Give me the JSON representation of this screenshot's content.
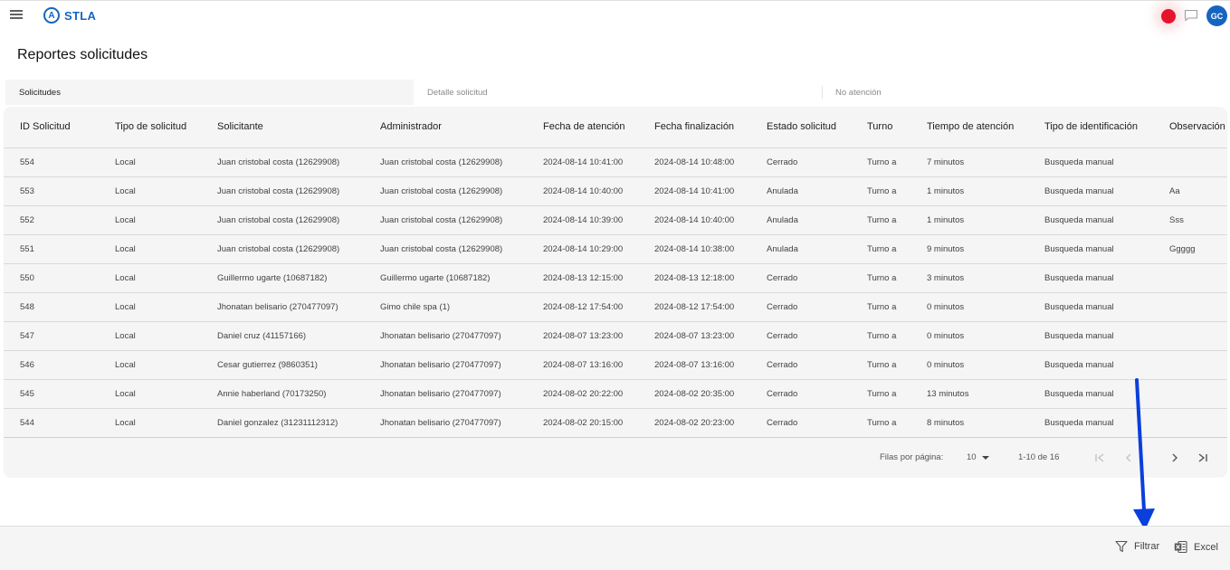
{
  "header": {
    "brand": "STLA",
    "logo_glyph": "A",
    "avatar_initials": "GC",
    "accent_color": "#1565c0",
    "record_color": "#e5142b"
  },
  "page": {
    "title": "Reportes solicitudes"
  },
  "tabs": [
    {
      "label": "Solicitudes",
      "active": true
    },
    {
      "label": "Detalle solicitud",
      "active": false
    },
    {
      "label": "No atención",
      "active": false
    }
  ],
  "table": {
    "columns": [
      "ID Solicitud",
      "Tipo de solicitud",
      "Solicitante",
      "Administrador",
      "Fecha de atención",
      "Fecha finalización",
      "Estado solicitud",
      "Turno",
      "Tiempo de atención",
      "Tipo de identificación",
      "Observación"
    ],
    "rows": [
      [
        "554",
        "Local",
        "Juan cristobal costa  (12629908)",
        "Juan cristobal costa  (12629908)",
        "2024-08-14 10:41:00",
        "2024-08-14 10:48:00",
        "Cerrado",
        "Turno a",
        "7 minutos",
        "Busqueda manual",
        ""
      ],
      [
        "553",
        "Local",
        "Juan cristobal costa  (12629908)",
        "Juan cristobal costa  (12629908)",
        "2024-08-14 10:40:00",
        "2024-08-14 10:41:00",
        "Anulada",
        "Turno a",
        "1 minutos",
        "Busqueda manual",
        "Aa"
      ],
      [
        "552",
        "Local",
        "Juan cristobal costa  (12629908)",
        "Juan cristobal costa  (12629908)",
        "2024-08-14 10:39:00",
        "2024-08-14 10:40:00",
        "Anulada",
        "Turno a",
        "1 minutos",
        "Busqueda manual",
        "Sss"
      ],
      [
        "551",
        "Local",
        "Juan cristobal costa  (12629908)",
        "Juan cristobal costa  (12629908)",
        "2024-08-14 10:29:00",
        "2024-08-14 10:38:00",
        "Anulada",
        "Turno a",
        "9 minutos",
        "Busqueda manual",
        "Ggggg"
      ],
      [
        "550",
        "Local",
        "Guillermo ugarte  (10687182)",
        "Guillermo ugarte  (10687182)",
        "2024-08-13 12:15:00",
        "2024-08-13 12:18:00",
        "Cerrado",
        "Turno a",
        "3 minutos",
        "Busqueda manual",
        ""
      ],
      [
        "548",
        "Local",
        "Jhonatan belisario  (270477097)",
        "Gimo chile spa (1)",
        "2024-08-12 17:54:00",
        "2024-08-12 17:54:00",
        "Cerrado",
        "Turno a",
        "0 minutos",
        "Busqueda manual",
        ""
      ],
      [
        "547",
        "Local",
        "Daniel cruz  (41157166)",
        "Jhonatan belisario  (270477097)",
        "2024-08-07 13:23:00",
        "2024-08-07 13:23:00",
        "Cerrado",
        "Turno a",
        "0 minutos",
        "Busqueda manual",
        ""
      ],
      [
        "546",
        "Local",
        "Cesar gutierrez  (9860351)",
        "Jhonatan belisario  (270477097)",
        "2024-08-07 13:16:00",
        "2024-08-07 13:16:00",
        "Cerrado",
        "Turno a",
        "0 minutos",
        "Busqueda manual",
        ""
      ],
      [
        "545",
        "Local",
        "Annie haberland  (70173250)",
        "Jhonatan belisario  (270477097)",
        "2024-08-02 20:22:00",
        "2024-08-02 20:35:00",
        "Cerrado",
        "Turno a",
        "13 minutos",
        "Busqueda manual",
        ""
      ],
      [
        "544",
        "Local",
        "Daniel gonzalez  (31231112312)",
        "Jhonatan belisario  (270477097)",
        "2024-08-02 20:15:00",
        "2024-08-02 20:23:00",
        "Cerrado",
        "Turno a",
        "8 minutos",
        "Busqueda manual",
        ""
      ]
    ]
  },
  "pagination": {
    "rows_label": "Filas por página:",
    "rows_value": "10",
    "range": "1-10 de 16"
  },
  "footer": {
    "filter_label": "Filtrar",
    "excel_label": "Excel"
  },
  "annotation": {
    "arrow_color": "#0a3fdc"
  }
}
